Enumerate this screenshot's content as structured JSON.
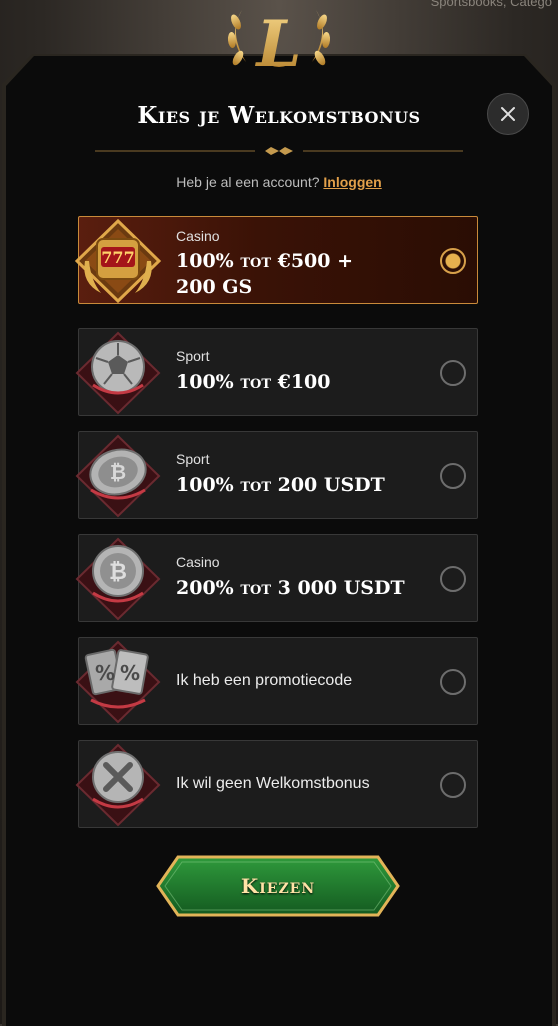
{
  "backdrop": {
    "text": "Sportsbooks, Catego"
  },
  "modal": {
    "title": "Kies je Welkomstbonus",
    "account_prompt": "Heb je al een account?",
    "login_link": "Inloggen",
    "choose_button": "Kiezen",
    "logo_letter": "L"
  },
  "options": [
    {
      "category": "Casino",
      "line1": "100% tot €500 +",
      "line2": "200 GS",
      "icon": "slot-777-icon",
      "selected": true
    },
    {
      "category": "Sport",
      "line1": "100% tot €100",
      "icon": "soccer-ball-icon",
      "selected": false
    },
    {
      "category": "Sport",
      "line1": "100% tot 200 USDT",
      "icon": "crypto-coin-icon",
      "selected": false
    },
    {
      "category": "Casino",
      "line1": "200% tot 3 000 USDT",
      "icon": "bitcoin-icon",
      "selected": false
    },
    {
      "text": "Ik heb een promotiecode",
      "icon": "percent-cards-icon",
      "selected": false
    },
    {
      "text": "Ik wil geen Welkomstbonus",
      "icon": "x-coin-icon",
      "selected": false
    }
  ],
  "colors": {
    "accent_gold": "#d7a04a",
    "login_link": "#e2a04a",
    "button_green": "#1f7a2e",
    "selected_bg": "#5a1e0f"
  }
}
